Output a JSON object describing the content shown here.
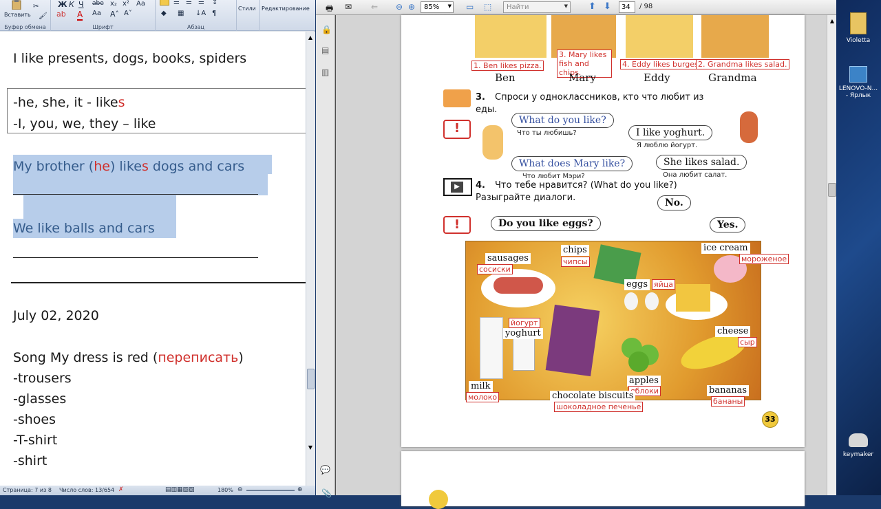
{
  "word": {
    "ribbon": {
      "paste_label": "Вставить",
      "clipboard_group": "Буфер обмена",
      "font_group": "Шрифт",
      "paragraph_group": "Абзац",
      "styles_label": "Стили",
      "editing_label": "Редактирование"
    },
    "document": {
      "line1": "I like presents, dogs, books, spiders",
      "rule_a": "-he, she, it - like",
      "rule_a_s": "s",
      "rule_b": "-I, you, we, they – like",
      "ex1_pre": "My brother (",
      "ex1_he": "he",
      "ex1_mid": ") like",
      "ex1_s": "s",
      "ex1_post": " dogs and cars",
      "ex2": "We like balls and cars",
      "date": "July 02, 2020",
      "song_pre": "Song My dress is red (",
      "song_red": "переписать",
      "song_post": ")",
      "items": [
        "-trousers",
        "-glasses",
        "-shoes",
        "-T-shirt",
        "-shirt"
      ]
    },
    "status": {
      "page": "Страница: 7 из 8",
      "words": "Число слов: 13/654",
      "zoom": "180%"
    }
  },
  "pdf": {
    "toolbar": {
      "zoom": "85%",
      "find_placeholder": "Найти",
      "page_current": "34",
      "page_total": "/ 98"
    },
    "top_names": [
      "Ben",
      "Mary",
      "Eddy",
      "Grandma"
    ],
    "top_captions": [
      "1. Ben likes pizza.",
      "3. Mary likes fish and chips.",
      "4. Eddy likes burges.",
      "2. Grandma likes salad."
    ],
    "ex3_num": "3.",
    "ex3_text_1": "Спроси у одноклассников, кто что любит из",
    "ex3_text_2": "еды.",
    "bubble_q1": "What do you like?",
    "bubble_q1_sub": "Что ты любишь?",
    "bubble_a1": "I like yoghurt.",
    "bubble_a1_sub": "Я люблю йогурт.",
    "bubble_q2": "What does Mary like?",
    "bubble_q2_sub": "Что любит Мэри?",
    "bubble_a2": "She likes salad.",
    "bubble_a2_sub": "Она любит салат.",
    "ex4_num": "4.",
    "ex4_text_1": "Что тебе нравится? (What do you like?)",
    "ex4_text_2": "Разыграйте диалоги.",
    "bubble_no": "No.",
    "bubble_eggs": "Do you like eggs?",
    "bubble_yes": "Yes.",
    "foods": [
      {
        "en": "sausages",
        "ru": "сосиски"
      },
      {
        "en": "chips",
        "ru": "чипсы"
      },
      {
        "en": "ice cream",
        "ru": "мороженое"
      },
      {
        "en": "eggs",
        "ru": "яйца"
      },
      {
        "en": "yoghurt",
        "ru": "йогурт"
      },
      {
        "en": "cheese",
        "ru": "сыр"
      },
      {
        "en": "milk",
        "ru": "молоко"
      },
      {
        "en": "apples",
        "ru": "яблоки"
      },
      {
        "en": "chocolate biscuits",
        "ru": "шоколадное печенье"
      },
      {
        "en": "bananas",
        "ru": "бананы"
      }
    ],
    "page_number": "33"
  },
  "desktop": {
    "icon1": "Violetta",
    "icon2a": "LENOVO-N...",
    "icon2b": "- Ярлык",
    "icon3": "keymaker"
  },
  "colors": {
    "accent_red": "#d0302c",
    "highlight": "#b7cdea",
    "text_blue": "#355c8c"
  }
}
